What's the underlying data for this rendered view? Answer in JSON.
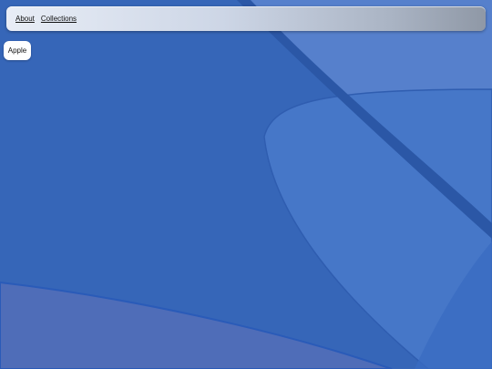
{
  "menubar": {
    "items": [
      {
        "label": "About"
      },
      {
        "label": "Collections"
      }
    ]
  },
  "desktop": {
    "items": [
      {
        "label": "Apple"
      }
    ]
  },
  "colors": {
    "wallpaper_base": "#3a6cc0",
    "menubar_light": "#e8edf6",
    "menubar_dark": "#8f98a6"
  }
}
